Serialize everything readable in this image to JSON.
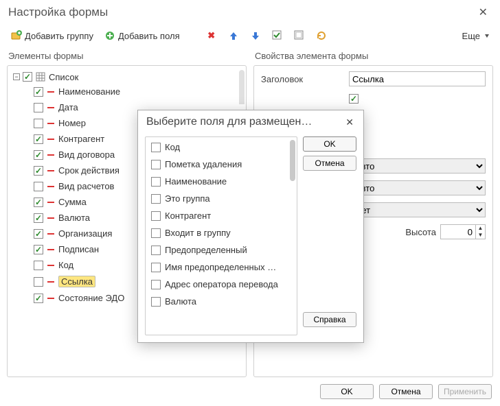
{
  "window": {
    "title": "Настройка формы"
  },
  "toolbar": {
    "add_group": "Добавить группу",
    "add_fields": "Добавить поля",
    "more": "Еще"
  },
  "left": {
    "header": "Элементы формы",
    "root": "Список",
    "items": [
      {
        "checked": true,
        "label": "Наименование"
      },
      {
        "checked": false,
        "label": "Дата"
      },
      {
        "checked": false,
        "label": "Номер"
      },
      {
        "checked": true,
        "label": "Контрагент"
      },
      {
        "checked": true,
        "label": "Вид договора"
      },
      {
        "checked": true,
        "label": "Срок действия"
      },
      {
        "checked": false,
        "label": "Вид расчетов"
      },
      {
        "checked": true,
        "label": "Сумма"
      },
      {
        "checked": true,
        "label": "Валюта"
      },
      {
        "checked": true,
        "label": "Организация"
      },
      {
        "checked": true,
        "label": "Подписан"
      },
      {
        "checked": false,
        "label": "Код"
      },
      {
        "checked": false,
        "label": "Ссылка",
        "selected": true
      },
      {
        "checked": true,
        "label": "Состояние ЭДО"
      }
    ]
  },
  "right": {
    "header": "Свойства элемента формы",
    "rows": {
      "title_label": "Заголовок",
      "title_value": "Ссылка",
      "width_opt1": "Авто",
      "width_opt2": "Авто",
      "width_opt3": "Нет",
      "height_label": "Высота",
      "height_value": "0"
    }
  },
  "footer": {
    "ok": "OK",
    "cancel": "Отмена",
    "apply": "Применить"
  },
  "modal": {
    "title": "Выберите поля для размещен…",
    "ok": "OK",
    "cancel": "Отмена",
    "help": "Справка",
    "fields": [
      "Код",
      "Пометка удаления",
      "Наименование",
      "Это группа",
      "Контрагент",
      "Входит в группу",
      "Предопределенный",
      "Имя предопределенных …",
      "Адрес оператора перевода",
      "Валюта"
    ]
  }
}
